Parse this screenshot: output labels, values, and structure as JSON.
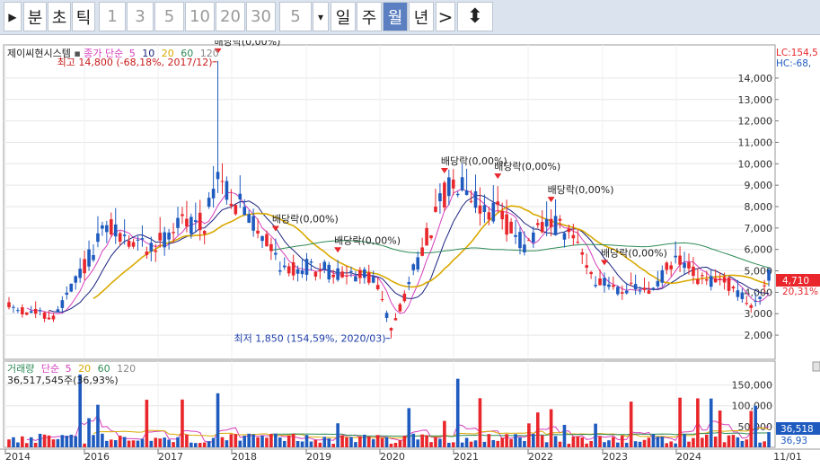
{
  "toolbar": {
    "play_glyph": "▶",
    "buttons": [
      "분",
      "초",
      "틱",
      "1",
      "3",
      "5",
      "10",
      "20",
      "30",
      "5",
      "일",
      "주",
      "월",
      "년"
    ],
    "dropdown_glyph": "▾",
    "next_glyph": ">",
    "updown_glyph": "⬍",
    "selected": "월"
  },
  "price_panel": {
    "stock_name": "제이씨현시스템",
    "legend_prefix": "종가 단순",
    "ma_periods": [
      "5",
      "10",
      "20",
      "60",
      "120"
    ],
    "lc_label": "LC:154,5",
    "hc_label": "HC:-68,",
    "high_note": "최고 14,800 (-68,18%, 2017/12)",
    "low_note": "최저 1,850 (154,59%, 2020/03)",
    "current_price": "4,710",
    "current_pct": "20,31%",
    "dividend_label": "배당락(0,00%)"
  },
  "volume_panel": {
    "title": "거래량",
    "legend_prefix": "단순",
    "ma_periods": [
      "5",
      "20",
      "60",
      "120"
    ],
    "last_volume": "36,517,545주(36,93%)",
    "current_value": "36,518",
    "current_pct": "36,93"
  },
  "colors": {
    "up": "#e8262b",
    "down": "#1f5bbf",
    "ma5": "#d63fbd",
    "ma10": "#1a237e",
    "ma20": "#d9a900",
    "ma60": "#2e8b57",
    "ma120": "#888888"
  },
  "chart_data": [
    {
      "type": "candlestick",
      "title": "제이씨현시스템",
      "y_axis_ticks": [
        2000,
        3000,
        4000,
        5000,
        6000,
        7000,
        8000,
        9000,
        10000,
        11000,
        12000,
        13000,
        14000
      ],
      "y_tick_labels": [
        "2,000",
        "3,000",
        "4,000",
        "5,000",
        "6,000",
        "7,000",
        "8,000",
        "9,000",
        "10,000",
        "11,000",
        "12,000",
        "13,000",
        "14,000"
      ],
      "x_labels": [
        "2014",
        "2016",
        "2017",
        "2018",
        "2019",
        "2020",
        "2021",
        "2022",
        "2023",
        "2024",
        "11/01"
      ],
      "annotations": [
        {
          "text": "최고 14,800 (-68,18%, 2017/12)",
          "value": 14800
        },
        {
          "text": "최저 1,850 (154,59%, 2020/03)",
          "value": 1850
        },
        {
          "text": "배당락(0,00%)",
          "date": "2017/12"
        },
        {
          "text": "배당락(0,00%)",
          "date": "2018/12"
        },
        {
          "text": "배당락(0,00%)",
          "date": "2019/12"
        },
        {
          "text": "배당락(0,00%)",
          "date": "2020/12"
        },
        {
          "text": "배당락(0,00%)",
          "date": "2021/12"
        },
        {
          "text": "배당락(0,00%)",
          "date": "2022/12"
        },
        {
          "text": "배당락(0,00%)",
          "date": "2023/12"
        }
      ],
      "current_value": 4710
    },
    {
      "type": "bar",
      "title": "거래량",
      "y_axis_ticks": [
        50000,
        100000,
        150000
      ],
      "y_tick_labels": [
        "50,000",
        "100,000",
        "150,000"
      ],
      "current_value": 36518
    }
  ]
}
